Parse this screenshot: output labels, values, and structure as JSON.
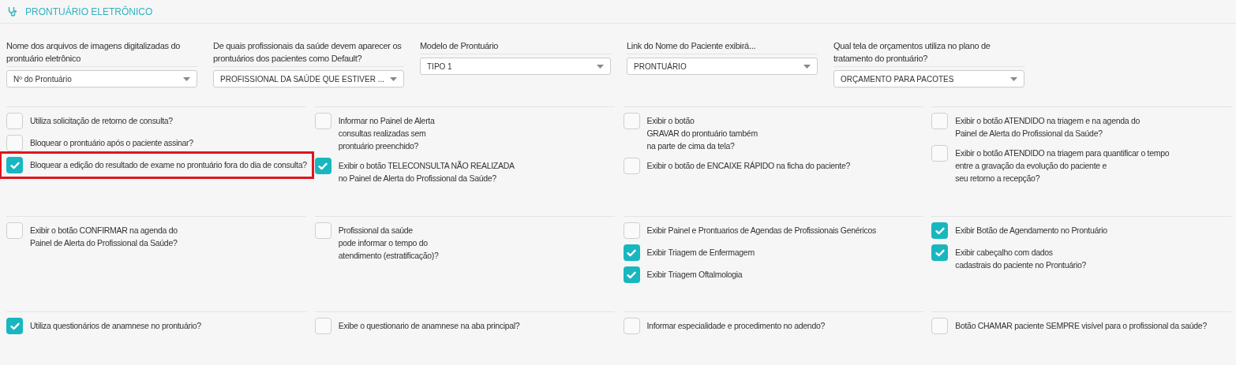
{
  "header": {
    "title": "PRONTUÁRIO ELETRÔNICO"
  },
  "selects": [
    {
      "label": "Nome dos arquivos de imagens digitalizadas do prontuário eletrônico",
      "value": "Nº do Prontuário"
    },
    {
      "label": "De quais profissionais da saúde devem aparecer os prontuários dos pacientes como Default?",
      "value": "PROFISSIONAL DA SAÚDE QUE ESTIVER ..."
    },
    {
      "label": "Modelo de Prontuário",
      "value": "TIPO 1"
    },
    {
      "label": "Link do Nome do Paciente exibirá...",
      "value": "PRONTUÁRIO"
    },
    {
      "label": "Qual tela de orçamentos utiliza no plano de tratamento do prontuário?",
      "value": "ORÇAMENTO PARA PACOTES"
    }
  ],
  "sections": [
    {
      "columns": [
        [
          {
            "label": "Utiliza solicitação de retorno de consulta?",
            "checked": false,
            "highlighted": false
          },
          {
            "label": "Bloquear o prontuário após o paciente assinar?",
            "checked": false,
            "highlighted": false
          },
          {
            "label": "Bloquear a edição do resultado de exame no prontuário fora do dia de consulta?",
            "checked": true,
            "highlighted": true
          }
        ],
        [
          {
            "label": "Informar no Painel de Alerta\nconsultas realizadas sem\nprontuário preenchido?",
            "checked": false,
            "highlighted": false
          },
          {
            "label": "Exibir o botão TELECONSULTA NÃO REALIZADA\nno Painel de Alerta do Profissional da Saúde?",
            "checked": true,
            "highlighted": false
          }
        ],
        [
          {
            "label": "Exibir o botão\nGRAVAR do prontuário também\nna parte de cima da tela?",
            "checked": false,
            "highlighted": false
          },
          {
            "label": "Exibir o botão de ENCAIXE RÁPIDO na ficha do paciente?",
            "checked": false,
            "highlighted": false
          }
        ],
        [
          {
            "label": "Exibir o botão ATENDIDO na triagem e na agenda do\nPainel de Alerta do Profissional da Saúde?",
            "checked": false,
            "highlighted": false
          },
          {
            "label": "Exibir o botão ATENDIDO na triagem para quantificar o tempo\nentre a gravação da evolução do paciente e\nseu retorno a recepção?",
            "checked": false,
            "highlighted": false
          }
        ]
      ]
    },
    {
      "columns": [
        [
          {
            "label": "Exibir o botão CONFIRMAR na agenda do\nPainel de Alerta do Profissional da Saúde?",
            "checked": false,
            "highlighted": false
          }
        ],
        [
          {
            "label": "Profissional da saúde\npode informar o tempo do\natendimento (estratificação)?",
            "checked": false,
            "highlighted": false
          }
        ],
        [
          {
            "label": "Exibir Painel e Prontuarios de Agendas de Profissionais Genéricos",
            "checked": false,
            "highlighted": false
          },
          {
            "label": "Exibir Triagem de Enfermagem",
            "checked": true,
            "highlighted": false
          },
          {
            "label": "Exibir Triagem Oftalmologia",
            "checked": true,
            "highlighted": false
          }
        ],
        [
          {
            "label": "Exibir Botão de Agendamento no Prontuário",
            "checked": true,
            "highlighted": false
          },
          {
            "label": "Exibir cabeçalho com dados\ncadastrais do paciente no Prontuário?",
            "checked": true,
            "highlighted": false
          }
        ]
      ]
    },
    {
      "columns": [
        [
          {
            "label": "Utiliza questionários de anamnese no prontuário?",
            "checked": true,
            "highlighted": false
          }
        ],
        [
          {
            "label": "Exibe o questionario de anamnese na aba principal?",
            "checked": false,
            "highlighted": false
          }
        ],
        [
          {
            "label": "Informar especialidade e procedimento no adendo?",
            "checked": false,
            "highlighted": false
          }
        ],
        [
          {
            "label": "Botão CHAMAR paciente SEMPRE visível para o profissional da saúde?",
            "checked": false,
            "highlighted": false
          }
        ]
      ]
    }
  ]
}
